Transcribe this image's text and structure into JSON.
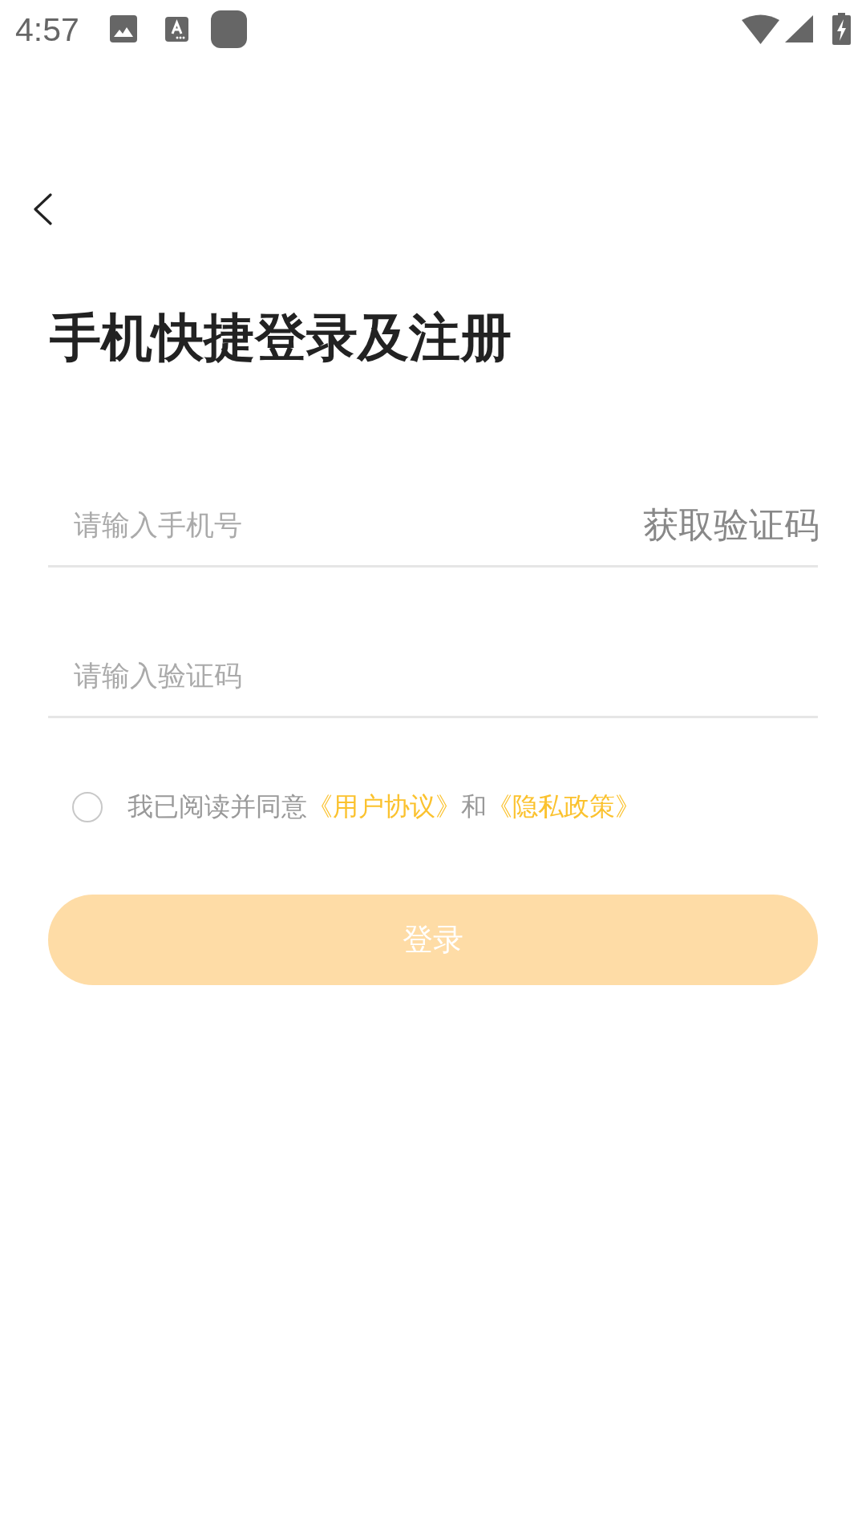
{
  "status_bar": {
    "time": "4:57"
  },
  "title": "手机快捷登录及注册",
  "phone_field": {
    "placeholder": "请输入手机号",
    "action": "获取验证码"
  },
  "code_field": {
    "placeholder": "请输入验证码"
  },
  "agreement": {
    "checked": false,
    "parts": [
      {
        "kind": "text",
        "text": "我已阅读并同意"
      },
      {
        "kind": "link",
        "text": "《用户协议》"
      },
      {
        "kind": "text",
        "text": "和"
      },
      {
        "kind": "link",
        "text": "《隐私政策》"
      }
    ]
  },
  "login_button": {
    "label": "登录",
    "disabled": true
  }
}
